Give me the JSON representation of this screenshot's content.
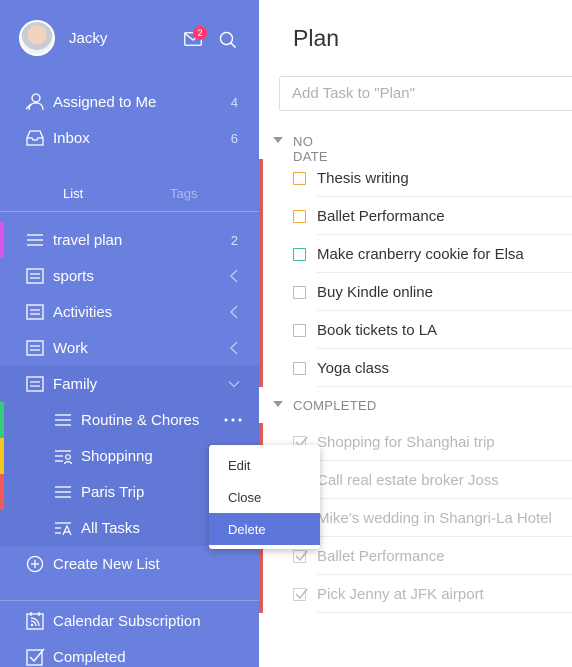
{
  "user": {
    "name": "Jacky",
    "unread_count": "2"
  },
  "nav": {
    "assigned": {
      "label": "Assigned to Me",
      "count": "4"
    },
    "inbox": {
      "label": "Inbox",
      "count": "6"
    }
  },
  "tabs": {
    "list": "List",
    "tags": "Tags"
  },
  "lists": {
    "travel": {
      "label": "travel plan",
      "count": "2"
    },
    "sports": {
      "label": "sports"
    },
    "activities": {
      "label": "Activities"
    },
    "work": {
      "label": "Work"
    },
    "family": {
      "label": "Family"
    },
    "routine": {
      "label": "Routine & Chores"
    },
    "shopping": {
      "label": "Shoppinng"
    },
    "paris": {
      "label": "Paris Trip"
    },
    "all": {
      "label": "All Tasks"
    }
  },
  "create_list": "Create New List",
  "calendar_subscription": "Calendar Subscription",
  "completed_nav": "Completed",
  "colors": {
    "sidebar": "#6a80de",
    "accent": "#5c76db",
    "priority_red": "#e0595b",
    "badge": "#ff3a6e"
  },
  "main": {
    "title": "Plan",
    "add_placeholder": "Add Task to \"Plan\"",
    "no_date_header": "NO DATE",
    "completed_header": "COMPLETED",
    "tasks": [
      {
        "label": "Thesis writing",
        "checkbox_color": "#f0a63a"
      },
      {
        "label": "Ballet Performance",
        "checkbox_color": "#f0a63a"
      },
      {
        "label": "Make cranberry cookie for Elsa",
        "checkbox_color": "#3cc08f"
      },
      {
        "label": "Buy Kindle online",
        "checkbox_color": "#bbbbbb"
      },
      {
        "label": "Book tickets to LA",
        "checkbox_color": "#bbbbbb"
      },
      {
        "label": "Yoga class",
        "checkbox_color": "#bbbbbb"
      }
    ],
    "completed_tasks": [
      {
        "label": "Shopping for Shanghai trip"
      },
      {
        "label": "Call real estate broker Joss"
      },
      {
        "label": "Mike’s wedding in Shangri-La Hotel"
      },
      {
        "label": "Ballet Performance"
      },
      {
        "label": "Pick Jenny at JFK airport"
      }
    ]
  },
  "context_menu": {
    "edit": "Edit",
    "close": "Close",
    "delete": "Delete"
  }
}
